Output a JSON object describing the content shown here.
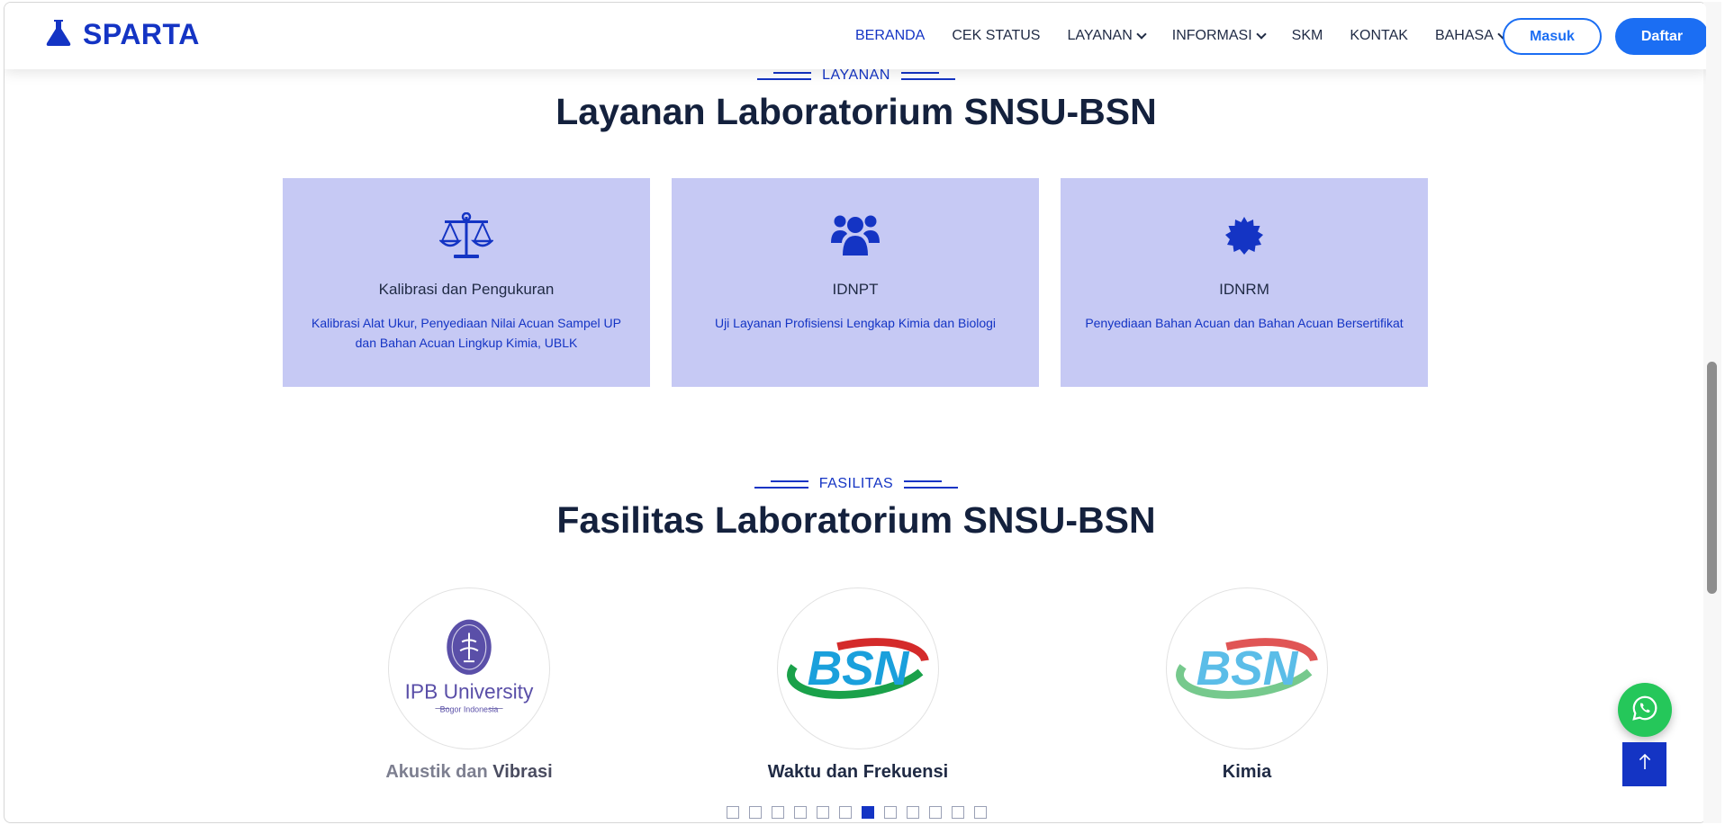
{
  "header": {
    "logo_text": "SPARTA",
    "logo_icon": "flask-icon",
    "nav": [
      {
        "label": "BERANDA",
        "active": true,
        "dropdown": false
      },
      {
        "label": "CEK STATUS",
        "active": false,
        "dropdown": false
      },
      {
        "label": "LAYANAN",
        "active": false,
        "dropdown": true
      },
      {
        "label": "INFORMASI",
        "active": false,
        "dropdown": true
      },
      {
        "label": "SKM",
        "active": false,
        "dropdown": false
      },
      {
        "label": "KONTAK",
        "active": false,
        "dropdown": false
      },
      {
        "label": "BAHASA",
        "active": false,
        "dropdown": true
      }
    ],
    "login_label": "Masuk",
    "register_label": "Daftar"
  },
  "services": {
    "eyebrow": "LAYANAN",
    "title": "Layanan Laboratorium SNSU-BSN",
    "cards": [
      {
        "icon": "balance-scale-icon",
        "title": "Kalibrasi dan Pengukuran",
        "desc": "Kalibrasi Alat Ukur, Penyediaan Nilai Acuan Sampel UP dan Bahan Acuan Lingkup Kimia, UBLK"
      },
      {
        "icon": "users-icon",
        "title": "IDNPT",
        "desc": "Uji Layanan Profisiensi Lengkap Kimia dan Biologi"
      },
      {
        "icon": "certificate-icon",
        "title": "IDNRM",
        "desc": "Penyediaan Bahan Acuan dan Bahan Acuan Bersertifikat"
      }
    ]
  },
  "facilities": {
    "eyebrow": "FASILITAS",
    "title": "Fasilitas Laboratorium SNSU-BSN",
    "items": [
      {
        "logo": "ipb-university-logo",
        "logo_text": "IPB University",
        "logo_subtext": "Bogor Indonesia",
        "name_part1": "Akustik dan",
        "name_part2": "Vibrasi"
      },
      {
        "logo": "bsn-logo",
        "logo_text": "BSN",
        "name": "Waktu dan Frekuensi"
      },
      {
        "logo": "bsn-logo",
        "logo_text": "BSN",
        "name": "Kimia"
      }
    ],
    "pager_count": 12,
    "pager_active": 7
  },
  "floating": {
    "whatsapp_icon": "whatsapp-icon",
    "top_icon": "arrow-up-icon"
  },
  "colors": {
    "brand": "#1434c4",
    "primary_button": "#1b6ef3",
    "card_bg": "#c6c9f4",
    "whatsapp": "#25c75a"
  }
}
